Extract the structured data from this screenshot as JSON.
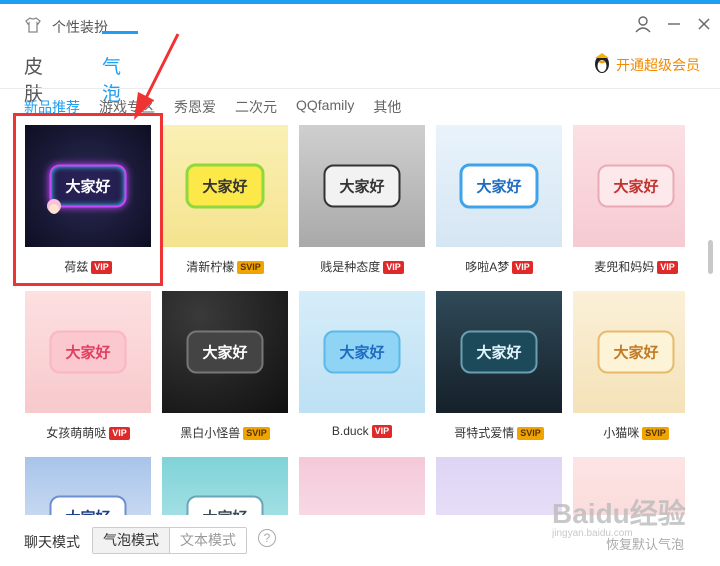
{
  "window": {
    "title": "个性装扮"
  },
  "header": {
    "vip_link": "开通超级会员"
  },
  "main_tabs": [
    {
      "label": "皮肤"
    },
    {
      "label": "气泡"
    }
  ],
  "sub_tabs": [
    {
      "label": "新品推荐"
    },
    {
      "label": "游戏专区"
    },
    {
      "label": "秀恩爱"
    },
    {
      "label": "二次元"
    },
    {
      "label": "QQfamily"
    },
    {
      "label": "其他"
    }
  ],
  "bubbles": [
    {
      "name": "荷兹",
      "badge": "VIP",
      "text": "大家好"
    },
    {
      "name": "清新柠檬",
      "badge": "SVIP",
      "text": "大家好"
    },
    {
      "name": "贱是种态度",
      "badge": "VIP",
      "text": "大家好"
    },
    {
      "name": "哆啦A梦",
      "badge": "VIP",
      "text": "大家好"
    },
    {
      "name": "麦兜和妈妈",
      "badge": "VIP",
      "text": "大家好"
    },
    {
      "name": "女孩萌萌哒",
      "badge": "VIP",
      "text": "大家好"
    },
    {
      "name": "黑白小怪兽",
      "badge": "SVIP",
      "text": "大家好"
    },
    {
      "name": "B.duck",
      "badge": "VIP",
      "text": "大家好"
    },
    {
      "name": "哥特式爱情",
      "badge": "SVIP",
      "text": "大家好"
    },
    {
      "name": "小猫咪",
      "badge": "SVIP",
      "text": "大家好"
    },
    {
      "name": "",
      "badge": "",
      "text": "大家好"
    },
    {
      "name": "",
      "badge": "",
      "text": "大家好"
    },
    {
      "name": "",
      "badge": "",
      "text": ""
    },
    {
      "name": "",
      "badge": "",
      "text": ""
    },
    {
      "name": "",
      "badge": "",
      "text": ""
    }
  ],
  "footer": {
    "mode_label": "聊天模式",
    "bubble_mode": "气泡模式",
    "text_mode": "文本模式",
    "help": "?",
    "watermark": "Baidu经验",
    "watermark_sub": "jingyan.baidu.com",
    "obscured_text": "恢复默认气泡"
  },
  "colors": {
    "accent": "#1e9ff2",
    "vip_orange": "#f08a00",
    "highlight_red": "#ef3333",
    "vip_badge": "#e02a2a",
    "svip_badge": "#f0a400"
  },
  "icons": {
    "title": "tshirt-icon",
    "user": "user-icon",
    "minimize": "minimize-icon",
    "close": "close-icon",
    "vip": "penguin-icon",
    "help": "help-icon"
  }
}
